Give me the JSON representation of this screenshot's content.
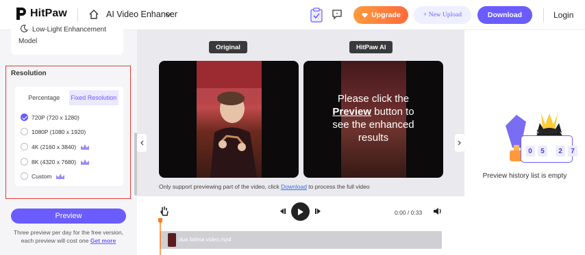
{
  "header": {
    "brand": "HitPaw",
    "product": "AI Video Enhancer",
    "upgrade_label": "Upgrade",
    "new_upload_label": "+ New Upload",
    "download_label": "Download",
    "login_label": "Login"
  },
  "left_panel": {
    "model_card": {
      "line1": "Low-Light Enhancement",
      "line2": "Model"
    },
    "resolution": {
      "title": "Resolution",
      "tabs": [
        {
          "label": "Percentage",
          "active": false
        },
        {
          "label": "Fixed Resolution",
          "active": true
        }
      ],
      "options": [
        {
          "label": "720P (720 x 1280)",
          "checked": true,
          "premium": false
        },
        {
          "label": "1080P (1080 x 1920)",
          "checked": false,
          "premium": false
        },
        {
          "label": "4K (2160 x 3840)",
          "checked": false,
          "premium": true
        },
        {
          "label": "8K (4320 x 7680)",
          "checked": false,
          "premium": true
        },
        {
          "label": "Custom",
          "checked": false,
          "premium": true
        }
      ]
    },
    "preview_label": "Preview",
    "note_line1": "Three preview per day for the free version,",
    "note_line2": "each preview will cost one",
    "note_link": "Get more"
  },
  "center": {
    "original_tag": "Original",
    "ai_tag": "HitPaw AI",
    "enh_line1": "Please click the",
    "enh_preview_word": "Preview",
    "enh_line2_suffix": " button to",
    "enh_line3": "see the enhanced",
    "enh_line4": "results",
    "hint_before": "Only support previewing part of the video, click ",
    "hint_link": "Download",
    "hint_after": " to process the full video"
  },
  "player": {
    "time_current": "0:00",
    "time_separator": " / ",
    "time_total": "0:33",
    "clip_name": "dua fatima video.mp4"
  },
  "right_panel": {
    "discount": "30%OFF",
    "countdown": [
      "0",
      "5",
      "2",
      "7"
    ],
    "empty_text": "Preview history list is empty"
  },
  "colors": {
    "accent": "#6a5cff",
    "upgrade_start": "#ff9a3c",
    "upgrade_end": "#ff6b3d",
    "highlight_border": "#e53935",
    "panel_bg": "#e9e9ee"
  }
}
